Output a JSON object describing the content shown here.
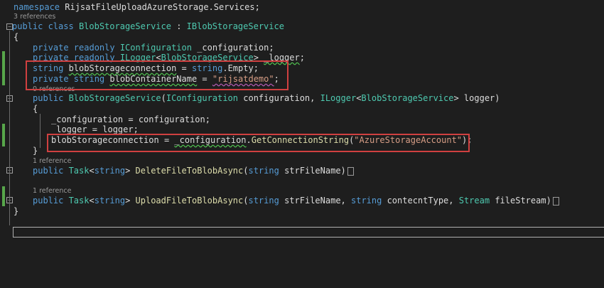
{
  "code": {
    "namespace_kw": "namespace",
    "namespace_name": " RijsatFileUploadAzureStorage.Services;",
    "lens_3refs": "3 references",
    "class_public": "public",
    "class_kw": " class ",
    "class_name": "BlobStorageService",
    "class_colon": " : ",
    "class_iface": "IBlobStorageService",
    "brace_open": "{",
    "brace_close": "}",
    "f1_mods": "private readonly ",
    "f1_type": "IConfiguration",
    "f1_name": " _configuration;",
    "f2_mods": "private readonly ",
    "f2_type": "ILogger",
    "f2_lt": "<",
    "f2_targ": "BlobStorageService",
    "f2_gt": "> ",
    "f2_name": "_logger",
    "f2_end": ";",
    "f3_type": "string ",
    "f3_name": "blobStorageconnection",
    "f3_eq": " = ",
    "f3_strkw": "string",
    "f3_val": ".Empty;",
    "f4_mods": "private string ",
    "f4_name": "blobContainerName",
    "f4_eq": " = ",
    "f4_val": "\"rijsatdemo\"",
    "f4_end": ";",
    "lens_0refs": "0 references",
    "ctor_public": "public ",
    "ctor_name": "BlobStorageService",
    "ctor_p1": "(",
    "ctor_t1": "IConfiguration",
    "ctor_n1": " configuration, ",
    "ctor_t2": "ILogger",
    "ctor_lt": "<",
    "ctor_targ": "BlobStorageService",
    "ctor_gt": "> ",
    "ctor_n2": "logger)",
    "ctor_open": "{",
    "ctor_s1": "_configuration = configuration;",
    "ctor_s2": "_logger = logger;",
    "ctor_s3_a": "blobStorageconnection = ",
    "ctor_s3_b": "_configuration",
    "ctor_s3_c": ".",
    "ctor_s3_d": "GetConnectionString",
    "ctor_s3_e": "(",
    "ctor_s3_f": "\"AzureStorageAccount\"",
    "ctor_s3_g": ");",
    "ctor_close": "}",
    "lens_1ref_a": "1 reference",
    "m1_public": "public ",
    "m1_task": "Task",
    "m1_lt": "<",
    "m1_str": "string",
    "m1_gt": "> ",
    "m1_name": "DeleteFileToBlobAsync",
    "m1_p": "(",
    "m1_pt": "string",
    "m1_pn": " strFileName)",
    "lens_1ref_b": "1 reference",
    "m2_public": "public ",
    "m2_task": "Task",
    "m2_lt": "<",
    "m2_str": "string",
    "m2_gt": "> ",
    "m2_name": "UploadFileToBlobAsync",
    "m2_p": "(",
    "m2_pt1": "string",
    "m2_pn1": " strFileName, ",
    "m2_pt2": "string",
    "m2_pn2": " contecntType, ",
    "m2_pt3": "Stream",
    "m2_pn3": " fileStream)",
    "class_close": "}",
    "fold_minus": "−",
    "fold_plus": "+"
  },
  "colors": {
    "background": "#1e1e1e",
    "keyword": "#569cd6",
    "type": "#4ec9b0",
    "string": "#d69d85",
    "method": "#dcdcaa",
    "highlight_box": "#d04040",
    "change_bar": "#57a64a"
  }
}
